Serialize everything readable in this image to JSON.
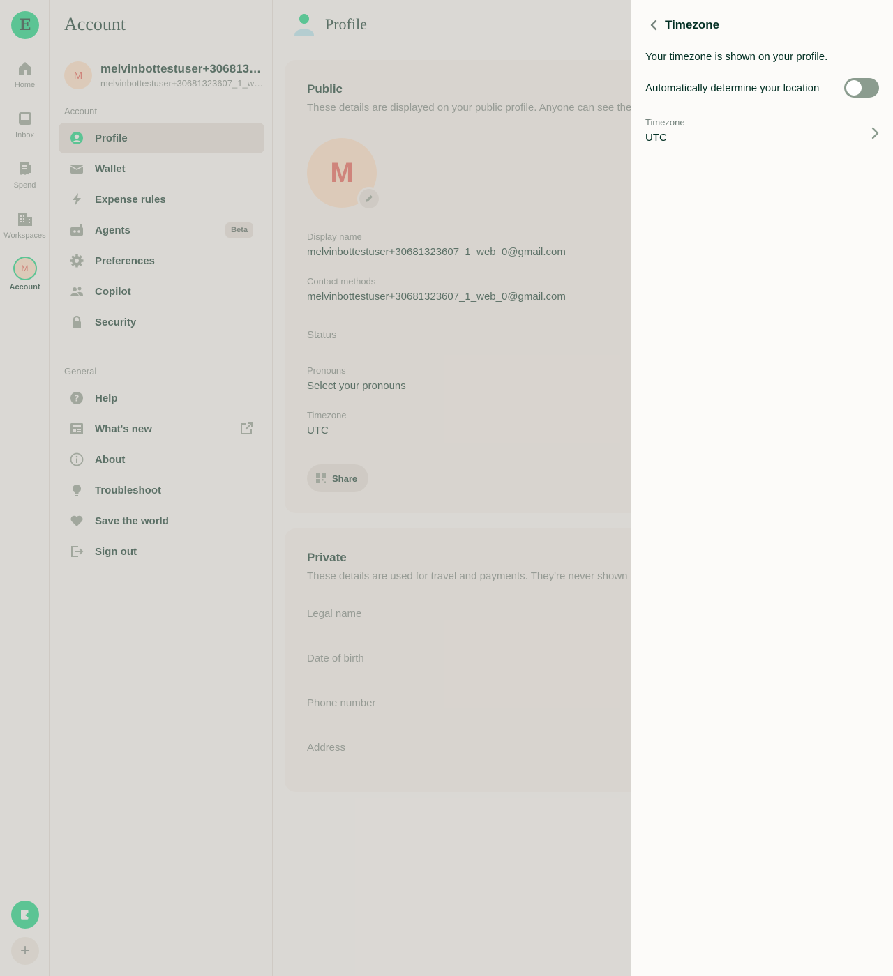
{
  "rail": {
    "logo_letter": "E",
    "items": [
      {
        "label": "Home",
        "icon": "home-icon"
      },
      {
        "label": "Inbox",
        "icon": "inbox-icon"
      },
      {
        "label": "Spend",
        "icon": "receipt-icon"
      },
      {
        "label": "Workspaces",
        "icon": "building-icon"
      },
      {
        "label": "Account",
        "icon": "avatar",
        "avatar_letter": "M"
      }
    ],
    "fab_icon": "new-expense-icon",
    "add_label": "+"
  },
  "account": {
    "title": "Account",
    "user": {
      "avatar_letter": "M",
      "display_name": "melvinbottestuser+3068132...",
      "email": "melvinbottestuser+30681323607_1_we..."
    },
    "section_account": "Account",
    "items": [
      {
        "label": "Profile",
        "icon": "user-circle-icon"
      },
      {
        "label": "Wallet",
        "icon": "wallet-icon"
      },
      {
        "label": "Expense rules",
        "icon": "lightning-icon"
      },
      {
        "label": "Agents",
        "icon": "robot-icon",
        "badge": "Beta"
      },
      {
        "label": "Preferences",
        "icon": "gear-icon"
      },
      {
        "label": "Copilot",
        "icon": "users-icon"
      },
      {
        "label": "Security",
        "icon": "lock-icon"
      }
    ],
    "section_general": "General",
    "general_items": [
      {
        "label": "Help",
        "icon": "question-icon"
      },
      {
        "label": "What's new",
        "icon": "newspaper-icon",
        "external": true
      },
      {
        "label": "About",
        "icon": "info-icon"
      },
      {
        "label": "Troubleshoot",
        "icon": "lightbulb-icon"
      },
      {
        "label": "Save the world",
        "icon": "heart-icon"
      },
      {
        "label": "Sign out",
        "icon": "sign-out-icon"
      }
    ]
  },
  "profile": {
    "title": "Profile",
    "public": {
      "heading": "Public",
      "subtitle": "These details are displayed on your public profile. Anyone can see them.",
      "avatar_letter": "M",
      "display_name_label": "Display name",
      "display_name_value": "melvinbottestuser+30681323607_1_web_0@gmail.com",
      "contact_label": "Contact methods",
      "contact_value": "melvinbottestuser+30681323607_1_web_0@gmail.com",
      "status_label": "Status",
      "pronouns_label": "Pronouns",
      "pronouns_value": "Select your pronouns",
      "timezone_label": "Timezone",
      "timezone_value": "UTC",
      "share_label": "Share"
    },
    "private": {
      "heading": "Private",
      "subtitle": "These details are used for travel and payments. They're never shown on your public profile.",
      "legal_name": "Legal name",
      "dob": "Date of birth",
      "phone": "Phone number",
      "address": "Address"
    }
  },
  "timezone_panel": {
    "title": "Timezone",
    "description": "Your timezone is shown on your profile.",
    "auto_label": "Automatically determine your location",
    "auto_enabled": false,
    "tz_label": "Timezone",
    "tz_value": "UTC"
  },
  "colors": {
    "brand_green": "#03D47C",
    "text_dark": "#002E22",
    "text_muted": "#76847E",
    "background": "#FCFBF9",
    "toggle_off": "#8B9C8F",
    "avatar_bg": "#FFE1C5",
    "avatar_text": "#E5564B"
  }
}
